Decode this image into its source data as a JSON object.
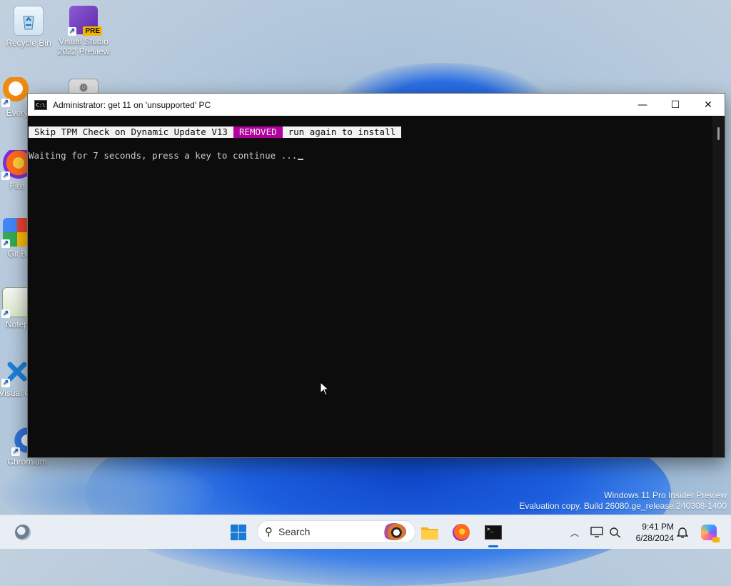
{
  "desktop": {
    "icons": [
      {
        "label": "Recycle Bin",
        "icon": "recycle-bin-icon"
      },
      {
        "label": "Visual Studio 2022 Preview",
        "icon": "visual-studio-icon",
        "badge": "PRE"
      },
      {
        "label": "Every",
        "icon": "everything-icon"
      },
      {
        "label": "Fire",
        "icon": "firefox-icon"
      },
      {
        "label": "Git B",
        "icon": "git-bash-icon"
      },
      {
        "label": "Notep",
        "icon": "notepad-icon"
      },
      {
        "label": "Visual Co",
        "icon": "vscode-icon"
      },
      {
        "label": "Chromium",
        "icon": "chromium-icon"
      }
    ],
    "watermark_line1": "Windows 11 Pro Insider Preview",
    "watermark_line2": "Evaluation copy. Build 26080.ge_release.240308-1400"
  },
  "window": {
    "title": "Administrator:  get 11 on 'unsupported' PC",
    "icon": "cmd-icon",
    "controls": {
      "minimize": "—",
      "maximize": "☐",
      "close": "✕"
    },
    "banner": {
      "part1": "Skip TPM Check on Dynamic Update V13",
      "part2": "REMOVED",
      "part3": "run again to install"
    },
    "line": "Waiting for 7 seconds, press a key to continue ...",
    "colors": {
      "background": "#0c0c0c",
      "text": "#cccccc",
      "highlight": "#b4009e"
    }
  },
  "taskbar": {
    "search_placeholder": "Search",
    "time": "9:41 PM",
    "date": "6/28/2024",
    "apps": [
      "start-icon",
      "file-explorer-icon",
      "firefox-icon",
      "terminal-icon"
    ],
    "accent": "#1a6ad8"
  }
}
